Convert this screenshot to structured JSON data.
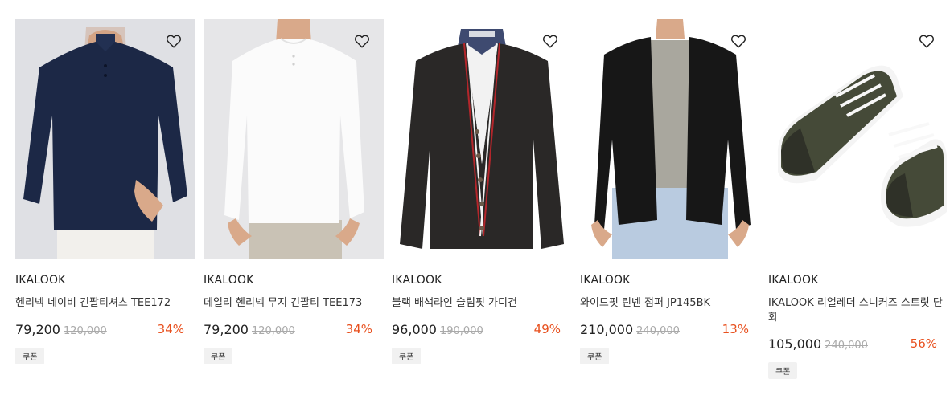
{
  "products": [
    {
      "brand": "IKALOOK",
      "title": "헨리넥 네이비 긴팔티셔츠 TEE172",
      "price": "79,200",
      "original_price": "120,000",
      "discount": "34%",
      "coupon": "쿠폰",
      "image_colors": {
        "bg": "#dfe0e4",
        "garment": "#1c2846",
        "skin": "#d9a98a",
        "pants": "#f2f0ec"
      }
    },
    {
      "brand": "IKALOOK",
      "title": "데일리 헨리넥 무지 긴팔티 TEE173",
      "price": "79,200",
      "original_price": "120,000",
      "discount": "34%",
      "coupon": "쿠폰",
      "image_colors": {
        "bg": "#e6e6e8",
        "garment": "#fbfbfb",
        "skin": "#d9a98a",
        "pants": "#c9c2b5"
      }
    },
    {
      "brand": "IKALOOK",
      "title": "블랙 배색라인 슬림핏 가디건",
      "price": "96,000",
      "original_price": "190,000",
      "discount": "49%",
      "coupon": "쿠폰",
      "image_colors": {
        "bg": "#ffffff",
        "garment": "#2a2827",
        "collar": "#3e4a70",
        "stripe_red": "#b3262b"
      }
    },
    {
      "brand": "IKALOOK",
      "title": "와이드핏 린넨 점퍼 JP145BK",
      "price": "210,000",
      "original_price": "240,000",
      "discount": "13%",
      "coupon": "쿠폰",
      "image_colors": {
        "bg": "#ffffff",
        "garment": "#171717",
        "inner": "#a9a79e",
        "jeans": "#b9cbe0",
        "skin": "#d9a98a"
      }
    },
    {
      "brand": "IKALOOK",
      "title": "IKALOOK 리얼레더 스니커즈 스트릿 단화",
      "price": "105,000",
      "original_price": "240,000",
      "discount": "56%",
      "coupon": "쿠폰",
      "image_colors": {
        "bg": "#ffffff",
        "suede": "#454a38",
        "leather": "#2f3128",
        "sole": "#f4f4f4",
        "lace": "#f8f8f8"
      }
    }
  ],
  "icons": {
    "wishlist": "heart-outline-icon"
  },
  "colors": {
    "discount": "#e8501e",
    "strike_price": "#aaaaaa"
  }
}
